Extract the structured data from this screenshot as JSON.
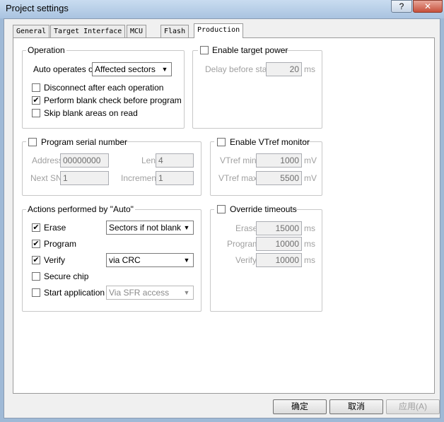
{
  "window": {
    "title": "Project settings",
    "help_button": "?",
    "close_button": "✕"
  },
  "tabs": [
    {
      "label": "General"
    },
    {
      "label": "Target Interface"
    },
    {
      "label": "MCU"
    },
    {
      "label": "Flash"
    },
    {
      "label": "Production"
    }
  ],
  "active_tab": "Production",
  "operation": {
    "title": "Operation",
    "auto_label": "Auto operates on",
    "auto_value": "Affected sectors",
    "disconnect": {
      "label": "Disconnect after each operation",
      "checked": false
    },
    "blank_check": {
      "label": "Perform blank check before program",
      "checked": true
    },
    "skip_blank": {
      "label": "Skip blank areas on read",
      "checked": false
    }
  },
  "target_power": {
    "title": "Enable target power",
    "checked": false,
    "delay_label": "Delay before start",
    "delay_value": "20",
    "delay_unit": "ms"
  },
  "serial": {
    "title": "Program serial number",
    "checked": false,
    "address_label": "Address",
    "address_value": "00000000",
    "len_label": "Len",
    "len_value": "4",
    "next_sn_label": "Next SN",
    "next_sn_value": "1",
    "increment_label": "Increment",
    "increment_value": "1"
  },
  "vtref": {
    "title": "Enable VTref monitor",
    "checked": false,
    "min_label": "VTref min.",
    "min_value": "1000",
    "min_unit": "mV",
    "max_label": "VTref max.",
    "max_value": "5500",
    "max_unit": "mV"
  },
  "auto_actions": {
    "title": "Actions performed by \"Auto\"",
    "erase": {
      "label": "Erase",
      "checked": true,
      "option": "Sectors if not blank"
    },
    "program": {
      "label": "Program",
      "checked": true
    },
    "verify": {
      "label": "Verify",
      "checked": true,
      "option": "via CRC"
    },
    "secure": {
      "label": "Secure chip",
      "checked": false
    },
    "start_app": {
      "label": "Start application",
      "checked": false,
      "option": "Via SFR access"
    }
  },
  "timeouts": {
    "title": "Override timeouts",
    "checked": false,
    "erase_label": "Erase",
    "erase_value": "15000",
    "erase_unit": "ms",
    "program_label": "Program",
    "program_value": "10000",
    "program_unit": "ms",
    "verify_label": "Verify",
    "verify_value": "10000",
    "verify_unit": "ms"
  },
  "buttons": {
    "ok": "确定",
    "cancel": "取消",
    "apply": "应用(A)"
  }
}
